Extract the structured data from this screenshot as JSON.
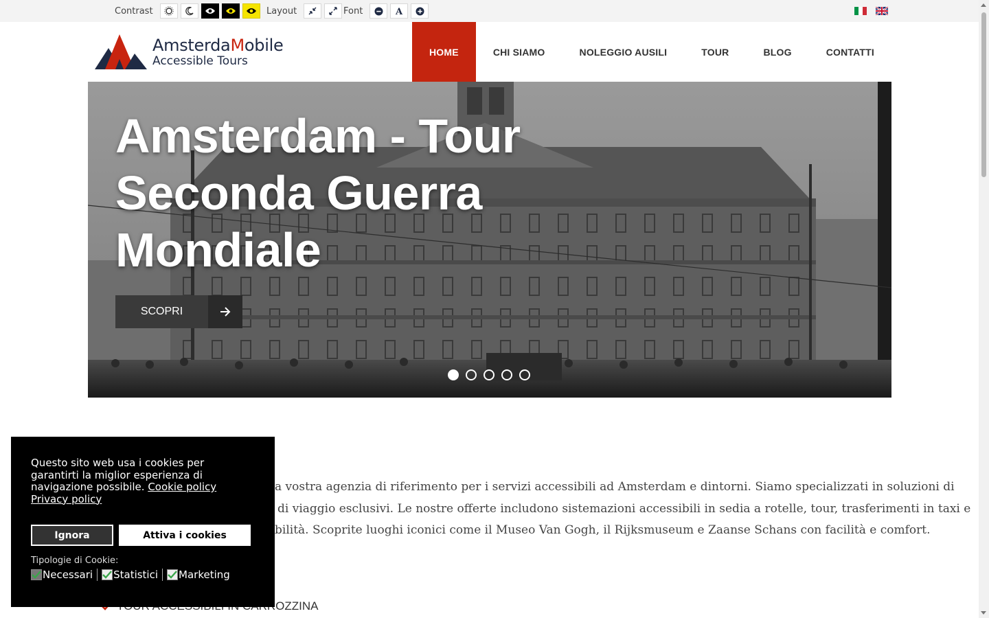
{
  "toolbar": {
    "contrast_label": "Contrast",
    "layout_label": "Layout",
    "font_label": "Font",
    "contrast_buttons": [
      "sun-icon",
      "moon-icon",
      "eye-icon",
      "eye-icon",
      "eye-icon"
    ],
    "layout_buttons": [
      "compress-icon",
      "expand-icon"
    ],
    "font_buttons": [
      "minus-circle-icon",
      "font-icon",
      "plus-circle-icon"
    ],
    "languages": [
      "it",
      "en"
    ]
  },
  "brand": {
    "name_part1": "Amsterda",
    "name_part2": "M",
    "name_part3": "obile",
    "subtitle": "Accessible Tours"
  },
  "nav": {
    "items": [
      "HOME",
      "CHI SIAMO",
      "NOLEGGIO AUSILI",
      "TOUR",
      "BLOG",
      "CONTATTI"
    ],
    "active": "HOME"
  },
  "hero": {
    "title": "Amsterdam - Tour Seconda Guerra Mondiale",
    "button_label": "SCOPRI",
    "slides": 5,
    "active_slide": 1
  },
  "intro": {
    "line1": "a vostra agenzia di riferimento per i servizi accessibili ad Amsterdam e dintorni. Siamo specializzati in soluzioni di",
    "line2": "di viaggio esclusivi. Le nostre offerte includono sistemazioni accessibili in sedia a rotelle, tour, trasferimenti in taxi e",
    "line3": "bilità. Scoprite luoghi iconici come il Museo Van Gogh, il Rijksmuseum e Zaanse Schans con facilità e comfort."
  },
  "features": {
    "first": "TOUR ACCESSIBILI IN CARROZZINA"
  },
  "cookie": {
    "message": "Questo sito web usa i cookies per garantirti la miglior esperienza di navigazione possibile.",
    "policy_link": "Cookie policy",
    "privacy_link": "Privacy policy",
    "ignore_label": "Ignora",
    "accept_label": "Attiva i cookies",
    "types_label": "Tipologie di Cookie:",
    "types": [
      "Necessari",
      "Statistici",
      "Marketing"
    ]
  },
  "colors": {
    "accent": "#c4250f",
    "brand_navy": "#1f2a44",
    "toolbar_bg": "#f3f3f3"
  }
}
